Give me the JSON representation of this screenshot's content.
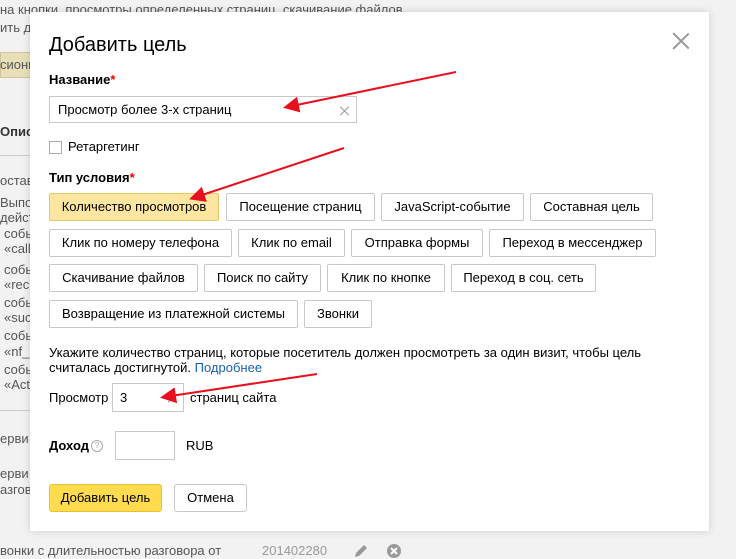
{
  "background": {
    "top_text": "на кнопки, просмотры определенных страниц, скачивание файлов.",
    "left_snippets": [
      "ить до",
      "сионн",
      "Описа",
      "остав",
      "Выпол",
      "дейст",
      "собы",
      "«call",
      "собы",
      "«rec",
      "собы",
      "«suc",
      "собы",
      "«nf_",
      "собы",
      "«Act",
      "ерви",
      "ерви",
      "азгов"
    ],
    "bottom_text": "вонки с длительностью разговора от",
    "bottom_number": "201402280"
  },
  "modal": {
    "title": "Добавить цель",
    "name_label": "Название",
    "required_mark": "*",
    "name_value": "Просмотр более 3-х страниц",
    "retargeting_label": "Ретаргетинг",
    "condition_label": "Тип условия",
    "conditions": [
      "Количество просмотров",
      "Посещение страниц",
      "JavaScript-событие",
      "Составная цель",
      "Клик по номеру телефона",
      "Клик по email",
      "Отправка формы",
      "Переход в мессенджер",
      "Скачивание файлов",
      "Поиск по сайту",
      "Клик по кнопке",
      "Переход в соц. сеть",
      "Возвращение из платежной системы",
      "Звонки"
    ],
    "active_condition": "Количество просмотров",
    "hint_text": "Укажите количество страниц, которые посетитель должен просмотреть за один визит, чтобы цель считалась достигнутой.",
    "hint_link": "Подробнее",
    "views_label": "Просмотр",
    "views_value": "3",
    "views_suffix": "страниц сайта",
    "income_label": "Доход",
    "income_value": "",
    "income_currency": "RUB",
    "submit_label": "Добавить цель",
    "cancel_label": "Отмена"
  },
  "colors": {
    "accent_yellow": "#ffdb4d",
    "active_chip": "#fde6a0",
    "arrow_red": "#e8101e",
    "link_blue": "#1a5fb4"
  }
}
